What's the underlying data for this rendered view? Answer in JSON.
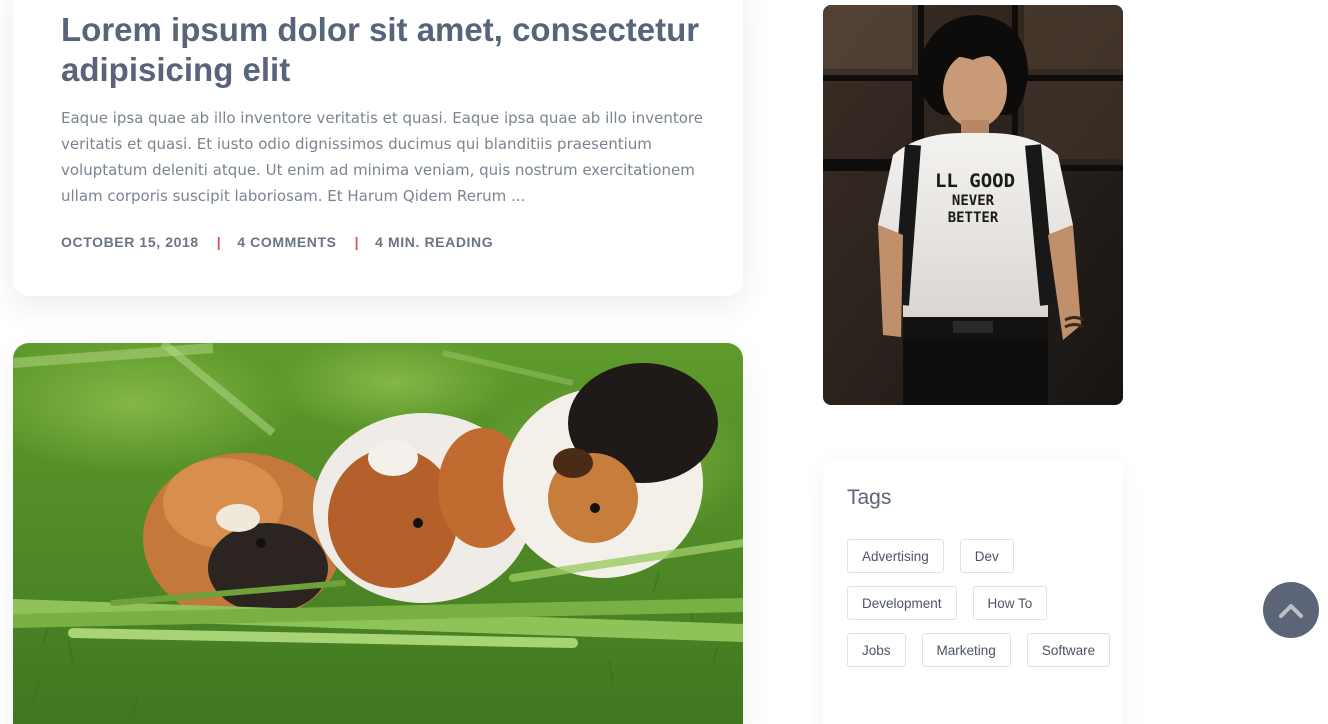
{
  "post": {
    "title": "Lorem ipsum dolor sit amet, consectetur adipisicing elit",
    "excerpt": "Eaque ipsa quae ab illo inventore veritatis et quasi. Eaque ipsa quae ab illo inventore veritatis et quasi. Et iusto odio dignissimos ducimus qui blanditiis praesentium voluptatum deleniti atque. Ut enim ad minima veniam, quis nostrum exercitationem ullam corporis suscipit laboriosam. Et Harum Qidem Rerum ...",
    "meta": {
      "date": "OCTOBER 15, 2018",
      "comments": "4 COMMENTS",
      "reading": "4 MIN. READING",
      "separator": "|"
    }
  },
  "tags_widget": {
    "title": "Tags",
    "tags": [
      "Advertising",
      "Dev",
      "Development",
      "How To",
      "Jobs",
      "Marketing",
      "Software"
    ]
  },
  "back_to_top": {
    "icon": "chevron-up-icon"
  },
  "colors": {
    "title": "#58647a",
    "accent_separator": "#e0525a",
    "back_to_top_bg": "#5c6577"
  }
}
